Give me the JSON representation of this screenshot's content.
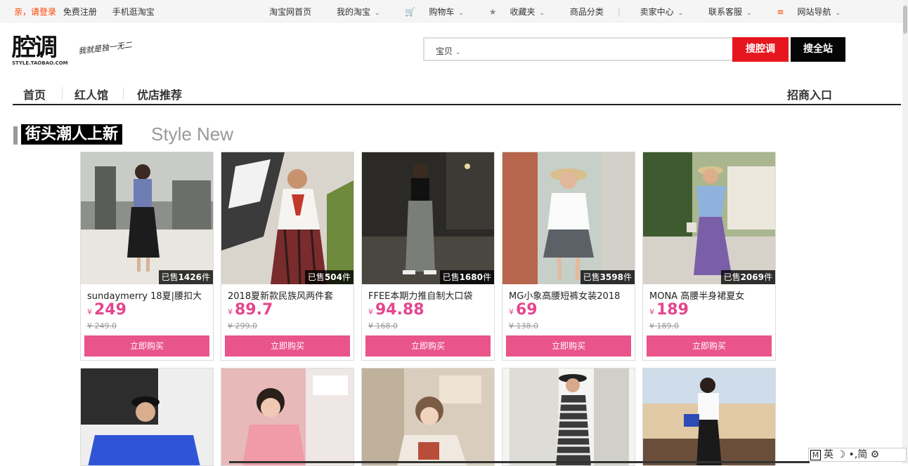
{
  "topbar": {
    "login": "亲，请登录",
    "register": "免费注册",
    "mobile": "手机逛淘宝",
    "right": [
      {
        "label": "淘宝网首页",
        "icon": "",
        "caret": false
      },
      {
        "label": "我的淘宝",
        "icon": "",
        "caret": true
      },
      {
        "label": "购物车",
        "icon": "cart-icon",
        "caret": true
      },
      {
        "label": "收藏夹",
        "icon": "star-icon",
        "caret": true
      },
      {
        "label": "商品分类",
        "icon": "",
        "caret": false
      },
      {
        "label": "卖家中心",
        "icon": "",
        "caret": true
      },
      {
        "label": "联系客服",
        "icon": "",
        "caret": true
      },
      {
        "label": "网站导航",
        "icon": "menu-icon",
        "caret": true
      }
    ]
  },
  "logo": {
    "text": "腔调",
    "sub": "STYLE.TAOBAO.COM",
    "slogan": "我就是独一无二"
  },
  "search": {
    "category": "宝贝",
    "placeholder": "",
    "btn_store": "搜腔调",
    "btn_all": "搜全站"
  },
  "nav": {
    "items": [
      "首页",
      "红人馆",
      "优店推荐"
    ],
    "right": "招商入口"
  },
  "section": {
    "title_cn": "街头潮人上新",
    "title_en": "Style New"
  },
  "products": [
    {
      "title": "sundaymerry 18夏|腰扣大",
      "price": "249",
      "orig": "249.0",
      "sold_prefix": "已售",
      "sold": "1426",
      "sold_unit": "件",
      "buy": "立即购买"
    },
    {
      "title": "2018夏新款民族风两件套",
      "price": "89.7",
      "orig": "299.0",
      "sold_prefix": "已售",
      "sold": "504",
      "sold_unit": "件",
      "buy": "立即购买"
    },
    {
      "title": "FFEE本期力推自制大口袋",
      "price": "94.88",
      "orig": "168.0",
      "sold_prefix": "已售",
      "sold": "1680",
      "sold_unit": "件",
      "buy": "立即购买"
    },
    {
      "title": "MG小象高腰短裤女装2018",
      "price": "69",
      "orig": "138.0",
      "sold_prefix": "已售",
      "sold": "3598",
      "sold_unit": "件",
      "buy": "立即购买"
    },
    {
      "title": "MONA 高腰半身裙夏女",
      "price": "189",
      "orig": "189.0",
      "sold_prefix": "已售",
      "sold": "2069",
      "sold_unit": "件",
      "buy": "立即购买"
    }
  ],
  "currency": "¥",
  "ime": {
    "m": "M",
    "lang": "英",
    "moon": "☽",
    "punc": "•,",
    "mode": "简",
    "gear": "⚙"
  }
}
